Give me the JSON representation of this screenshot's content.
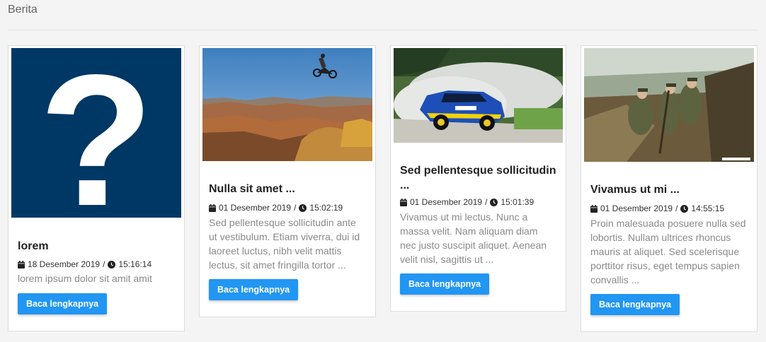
{
  "page": {
    "title": "Berita"
  },
  "colors": {
    "accent": "#2196f3",
    "placeholder_bg": "#003865"
  },
  "cards": [
    {
      "image": "question-mark-placeholder",
      "title": "lorem",
      "date": "18 Desember 2019",
      "sep": "/",
      "time": "15:16:14",
      "excerpt": "lorem ipsum dolor sit amit amit",
      "button": "Baca lengkapnya"
    },
    {
      "image": "motocross-jump-canyon-photo",
      "title": "Nulla sit amet ...",
      "date": "01 Desember 2019",
      "sep": "/",
      "time": "15:02:19",
      "excerpt": "Sed pellentesque sollicitudin ante ut vestibulum. Etiam viverra, dui id laoreet luctus, nibh velit mattis lectus, sit amet fringilla tortor ...",
      "button": "Baca lengkapnya"
    },
    {
      "image": "rally-car-photo",
      "title": "Sed pellentesque sollicitudin ...",
      "date": "01 Desember 2019",
      "sep": "/",
      "time": "15:01:39",
      "excerpt": "Vivamus ut mi lectus. Nunc a massa velit. Nam aliquam diam nec justo suscipit aliquet. Aenean velit nisl, sagittis ut ...",
      "button": "Baca lengkapnya"
    },
    {
      "image": "war-diorama-photo",
      "title": "Vivamus ut mi ...",
      "date": "01 Desember 2019",
      "sep": "/",
      "time": "14:55:15",
      "excerpt": "Proin malesuada posuere nulla sed lobortis. Nullam ultrices rhoncus mauris at aliquet. Sed scelerisque porttitor risus, eget tempus sapien convallis ...",
      "button": "Baca lengkapnya"
    }
  ]
}
